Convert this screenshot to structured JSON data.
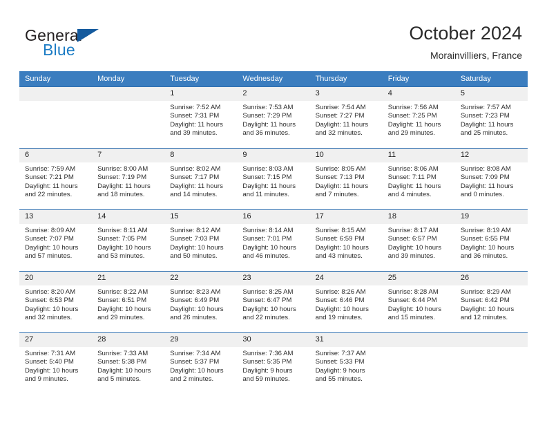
{
  "brand": {
    "name_part1": "General",
    "name_part2": "Blue",
    "colors": {
      "dark": "#231f20",
      "blue": "#1a7bc4",
      "triangle": "#145a9e"
    }
  },
  "header": {
    "title": "October 2024",
    "subtitle": "Morainvilliers, France"
  },
  "theme": {
    "header_blue": "#3b7dbf",
    "row_rule_blue": "#2f6fb0",
    "daynum_band": "#f0f0f0",
    "text": "#2d2d2d"
  },
  "columns": [
    "Sunday",
    "Monday",
    "Tuesday",
    "Wednesday",
    "Thursday",
    "Friday",
    "Saturday"
  ],
  "labels": {
    "sunrise": "Sunrise:",
    "sunset": "Sunset:",
    "daylight": "Daylight:"
  },
  "weeks": [
    [
      {
        "day": "",
        "blank": true,
        "sunrise": "",
        "sunset": "",
        "daylight1": "",
        "daylight2": ""
      },
      {
        "day": "",
        "blank": true,
        "sunrise": "",
        "sunset": "",
        "daylight1": "",
        "daylight2": ""
      },
      {
        "day": "1",
        "sunrise": "Sunrise: 7:52 AM",
        "sunset": "Sunset: 7:31 PM",
        "daylight1": "Daylight: 11 hours",
        "daylight2": "and 39 minutes."
      },
      {
        "day": "2",
        "sunrise": "Sunrise: 7:53 AM",
        "sunset": "Sunset: 7:29 PM",
        "daylight1": "Daylight: 11 hours",
        "daylight2": "and 36 minutes."
      },
      {
        "day": "3",
        "sunrise": "Sunrise: 7:54 AM",
        "sunset": "Sunset: 7:27 PM",
        "daylight1": "Daylight: 11 hours",
        "daylight2": "and 32 minutes."
      },
      {
        "day": "4",
        "sunrise": "Sunrise: 7:56 AM",
        "sunset": "Sunset: 7:25 PM",
        "daylight1": "Daylight: 11 hours",
        "daylight2": "and 29 minutes."
      },
      {
        "day": "5",
        "sunrise": "Sunrise: 7:57 AM",
        "sunset": "Sunset: 7:23 PM",
        "daylight1": "Daylight: 11 hours",
        "daylight2": "and 25 minutes."
      }
    ],
    [
      {
        "day": "6",
        "sunrise": "Sunrise: 7:59 AM",
        "sunset": "Sunset: 7:21 PM",
        "daylight1": "Daylight: 11 hours",
        "daylight2": "and 22 minutes."
      },
      {
        "day": "7",
        "sunrise": "Sunrise: 8:00 AM",
        "sunset": "Sunset: 7:19 PM",
        "daylight1": "Daylight: 11 hours",
        "daylight2": "and 18 minutes."
      },
      {
        "day": "8",
        "sunrise": "Sunrise: 8:02 AM",
        "sunset": "Sunset: 7:17 PM",
        "daylight1": "Daylight: 11 hours",
        "daylight2": "and 14 minutes."
      },
      {
        "day": "9",
        "sunrise": "Sunrise: 8:03 AM",
        "sunset": "Sunset: 7:15 PM",
        "daylight1": "Daylight: 11 hours",
        "daylight2": "and 11 minutes."
      },
      {
        "day": "10",
        "sunrise": "Sunrise: 8:05 AM",
        "sunset": "Sunset: 7:13 PM",
        "daylight1": "Daylight: 11 hours",
        "daylight2": "and 7 minutes."
      },
      {
        "day": "11",
        "sunrise": "Sunrise: 8:06 AM",
        "sunset": "Sunset: 7:11 PM",
        "daylight1": "Daylight: 11 hours",
        "daylight2": "and 4 minutes."
      },
      {
        "day": "12",
        "sunrise": "Sunrise: 8:08 AM",
        "sunset": "Sunset: 7:09 PM",
        "daylight1": "Daylight: 11 hours",
        "daylight2": "and 0 minutes."
      }
    ],
    [
      {
        "day": "13",
        "sunrise": "Sunrise: 8:09 AM",
        "sunset": "Sunset: 7:07 PM",
        "daylight1": "Daylight: 10 hours",
        "daylight2": "and 57 minutes."
      },
      {
        "day": "14",
        "sunrise": "Sunrise: 8:11 AM",
        "sunset": "Sunset: 7:05 PM",
        "daylight1": "Daylight: 10 hours",
        "daylight2": "and 53 minutes."
      },
      {
        "day": "15",
        "sunrise": "Sunrise: 8:12 AM",
        "sunset": "Sunset: 7:03 PM",
        "daylight1": "Daylight: 10 hours",
        "daylight2": "and 50 minutes."
      },
      {
        "day": "16",
        "sunrise": "Sunrise: 8:14 AM",
        "sunset": "Sunset: 7:01 PM",
        "daylight1": "Daylight: 10 hours",
        "daylight2": "and 46 minutes."
      },
      {
        "day": "17",
        "sunrise": "Sunrise: 8:15 AM",
        "sunset": "Sunset: 6:59 PM",
        "daylight1": "Daylight: 10 hours",
        "daylight2": "and 43 minutes."
      },
      {
        "day": "18",
        "sunrise": "Sunrise: 8:17 AM",
        "sunset": "Sunset: 6:57 PM",
        "daylight1": "Daylight: 10 hours",
        "daylight2": "and 39 minutes."
      },
      {
        "day": "19",
        "sunrise": "Sunrise: 8:19 AM",
        "sunset": "Sunset: 6:55 PM",
        "daylight1": "Daylight: 10 hours",
        "daylight2": "and 36 minutes."
      }
    ],
    [
      {
        "day": "20",
        "sunrise": "Sunrise: 8:20 AM",
        "sunset": "Sunset: 6:53 PM",
        "daylight1": "Daylight: 10 hours",
        "daylight2": "and 32 minutes."
      },
      {
        "day": "21",
        "sunrise": "Sunrise: 8:22 AM",
        "sunset": "Sunset: 6:51 PM",
        "daylight1": "Daylight: 10 hours",
        "daylight2": "and 29 minutes."
      },
      {
        "day": "22",
        "sunrise": "Sunrise: 8:23 AM",
        "sunset": "Sunset: 6:49 PM",
        "daylight1": "Daylight: 10 hours",
        "daylight2": "and 26 minutes."
      },
      {
        "day": "23",
        "sunrise": "Sunrise: 8:25 AM",
        "sunset": "Sunset: 6:47 PM",
        "daylight1": "Daylight: 10 hours",
        "daylight2": "and 22 minutes."
      },
      {
        "day": "24",
        "sunrise": "Sunrise: 8:26 AM",
        "sunset": "Sunset: 6:46 PM",
        "daylight1": "Daylight: 10 hours",
        "daylight2": "and 19 minutes."
      },
      {
        "day": "25",
        "sunrise": "Sunrise: 8:28 AM",
        "sunset": "Sunset: 6:44 PM",
        "daylight1": "Daylight: 10 hours",
        "daylight2": "and 15 minutes."
      },
      {
        "day": "26",
        "sunrise": "Sunrise: 8:29 AM",
        "sunset": "Sunset: 6:42 PM",
        "daylight1": "Daylight: 10 hours",
        "daylight2": "and 12 minutes."
      }
    ],
    [
      {
        "day": "27",
        "sunrise": "Sunrise: 7:31 AM",
        "sunset": "Sunset: 5:40 PM",
        "daylight1": "Daylight: 10 hours",
        "daylight2": "and 9 minutes."
      },
      {
        "day": "28",
        "sunrise": "Sunrise: 7:33 AM",
        "sunset": "Sunset: 5:38 PM",
        "daylight1": "Daylight: 10 hours",
        "daylight2": "and 5 minutes."
      },
      {
        "day": "29",
        "sunrise": "Sunrise: 7:34 AM",
        "sunset": "Sunset: 5:37 PM",
        "daylight1": "Daylight: 10 hours",
        "daylight2": "and 2 minutes."
      },
      {
        "day": "30",
        "sunrise": "Sunrise: 7:36 AM",
        "sunset": "Sunset: 5:35 PM",
        "daylight1": "Daylight: 9 hours",
        "daylight2": "and 59 minutes."
      },
      {
        "day": "31",
        "sunrise": "Sunrise: 7:37 AM",
        "sunset": "Sunset: 5:33 PM",
        "daylight1": "Daylight: 9 hours",
        "daylight2": "and 55 minutes."
      },
      {
        "day": "",
        "blank": true,
        "sunrise": "",
        "sunset": "",
        "daylight1": "",
        "daylight2": ""
      },
      {
        "day": "",
        "blank": true,
        "sunrise": "",
        "sunset": "",
        "daylight1": "",
        "daylight2": ""
      }
    ]
  ]
}
